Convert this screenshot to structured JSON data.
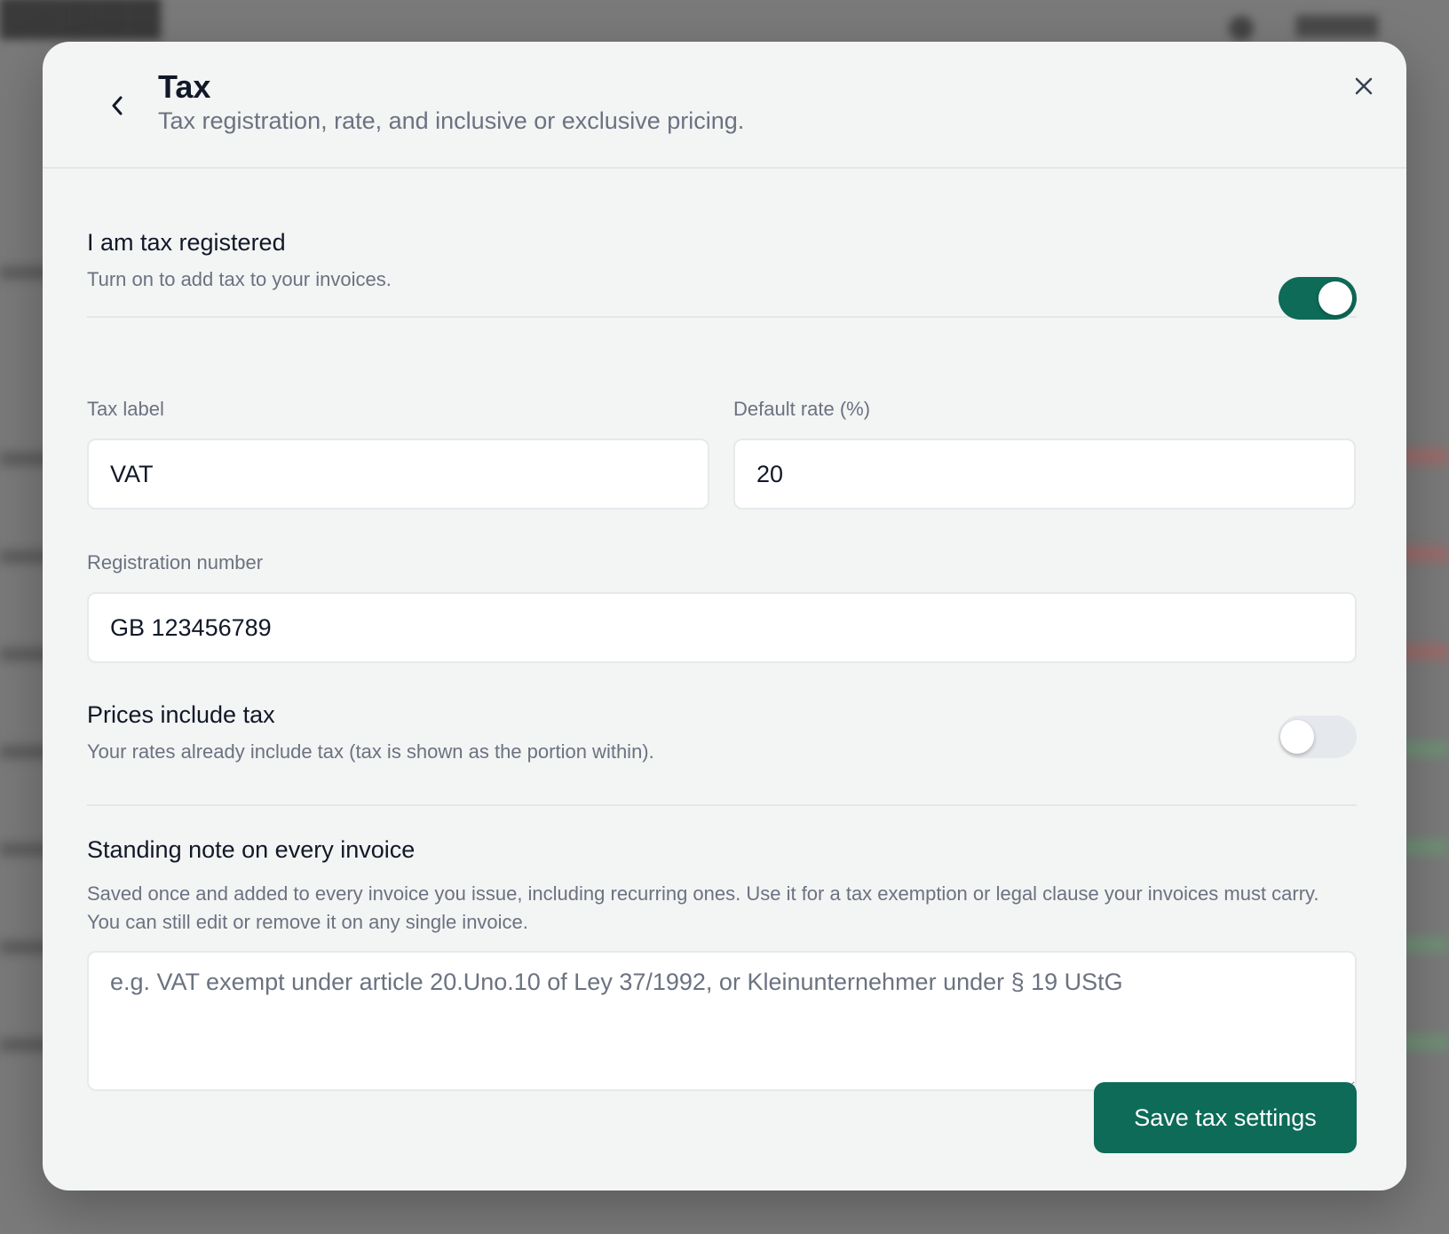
{
  "header": {
    "title": "Tax",
    "subtitle": "Tax registration, rate, and inclusive or exclusive pricing."
  },
  "tax_registered": {
    "title": "I am tax registered",
    "description": "Turn on to add tax to your invoices.",
    "enabled": true
  },
  "tax_label": {
    "label": "Tax label",
    "value": "VAT"
  },
  "default_rate": {
    "label": "Default rate (%)",
    "value": "20"
  },
  "registration_number": {
    "label": "Registration number",
    "value": "GB 123456789"
  },
  "prices_include_tax": {
    "title": "Prices include tax",
    "description": "Your rates already include tax (tax is shown as the portion within).",
    "enabled": false
  },
  "standing_note": {
    "title": "Standing note on every invoice",
    "description": "Saved once and added to every invoice you issue, including recurring ones. Use it for a tax exemption or legal clause your invoices must carry. You can still edit or remove it on any single invoice.",
    "placeholder": "e.g. VAT exempt under article 20.Uno.10 of Ley 37/1992, or Kleinunternehmer under § 19 UStG",
    "value": ""
  },
  "actions": {
    "save_label": "Save tax settings"
  },
  "colors": {
    "accent": "#0d6b58",
    "modal_bg": "#f3f4f4",
    "overlay": "#7d7d7d"
  },
  "icons": {
    "back": "chevron-left-icon",
    "close": "close-icon"
  }
}
